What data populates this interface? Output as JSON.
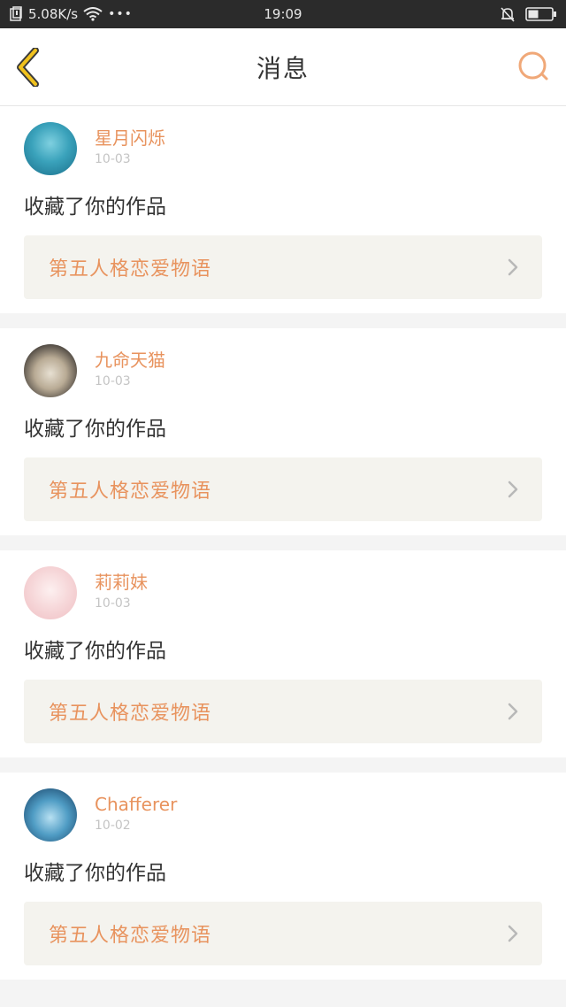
{
  "status_bar": {
    "speed": "5.08K/s",
    "dots": "•••",
    "time": "19:09"
  },
  "header": {
    "title": "消息",
    "back_icon": "chevron-left-icon",
    "search_icon": "search-icon",
    "accent_color": "#e8935e"
  },
  "messages": [
    {
      "username": "星月闪烁",
      "date": "10-03",
      "action": "收藏了你的作品",
      "work_title": "第五人格恋爱物语",
      "avatar_colors": [
        "#1a6e8a",
        "#7fd0e0"
      ]
    },
    {
      "username": "九命天猫",
      "date": "10-03",
      "action": "收藏了你的作品",
      "work_title": "第五人格恋爱物语",
      "avatar_colors": [
        "#2e2a28",
        "#d9d1c2"
      ]
    },
    {
      "username": "莉莉妹",
      "date": "10-03",
      "action": "收藏了你的作品",
      "work_title": "第五人格恋爱物语",
      "avatar_colors": [
        "#f3c9cc",
        "#fdf0f0"
      ]
    },
    {
      "username": "Chafferer",
      "date": "10-02",
      "action": "收藏了你的作品",
      "work_title": "第五人格恋爱物语",
      "avatar_colors": [
        "#143a5e",
        "#8fc8e6"
      ]
    }
  ]
}
